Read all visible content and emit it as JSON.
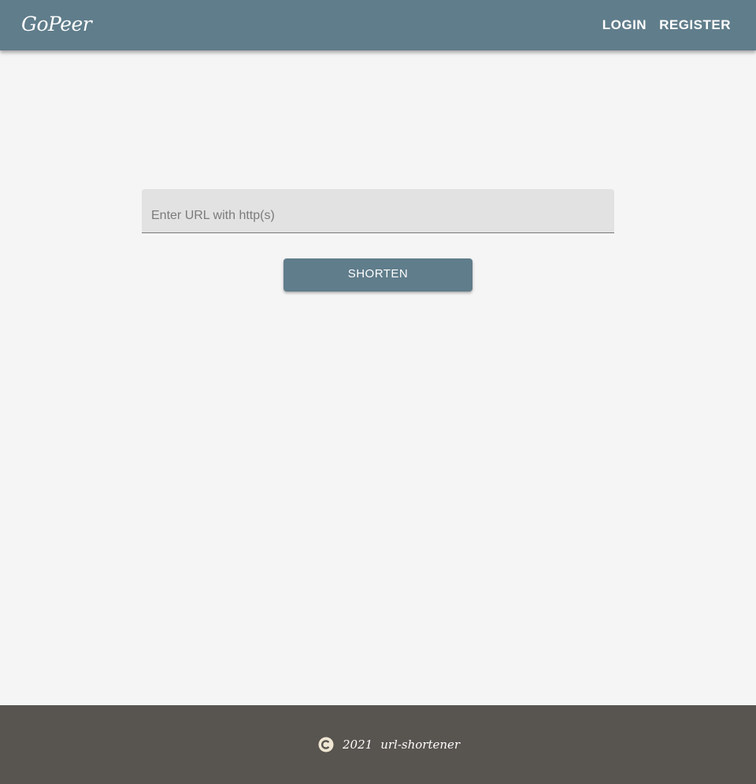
{
  "header": {
    "brand": "GoPeer",
    "nav": {
      "login_label": "LOGIN",
      "register_label": "REGISTER"
    }
  },
  "form": {
    "url_input": {
      "placeholder": "Enter URL with http(s)",
      "value": ""
    },
    "shorten_label": "SHORTEN"
  },
  "footer": {
    "icon": "copyright-icon",
    "year": "2021",
    "app_name": "url-shortener"
  },
  "colors": {
    "primary": "#607d8b",
    "background": "#f5f5f5",
    "input_background": "#e2e2e2",
    "footer_background": "#585450",
    "text_on_primary": "#ffffff",
    "copyright_icon": "#efe6d3"
  }
}
